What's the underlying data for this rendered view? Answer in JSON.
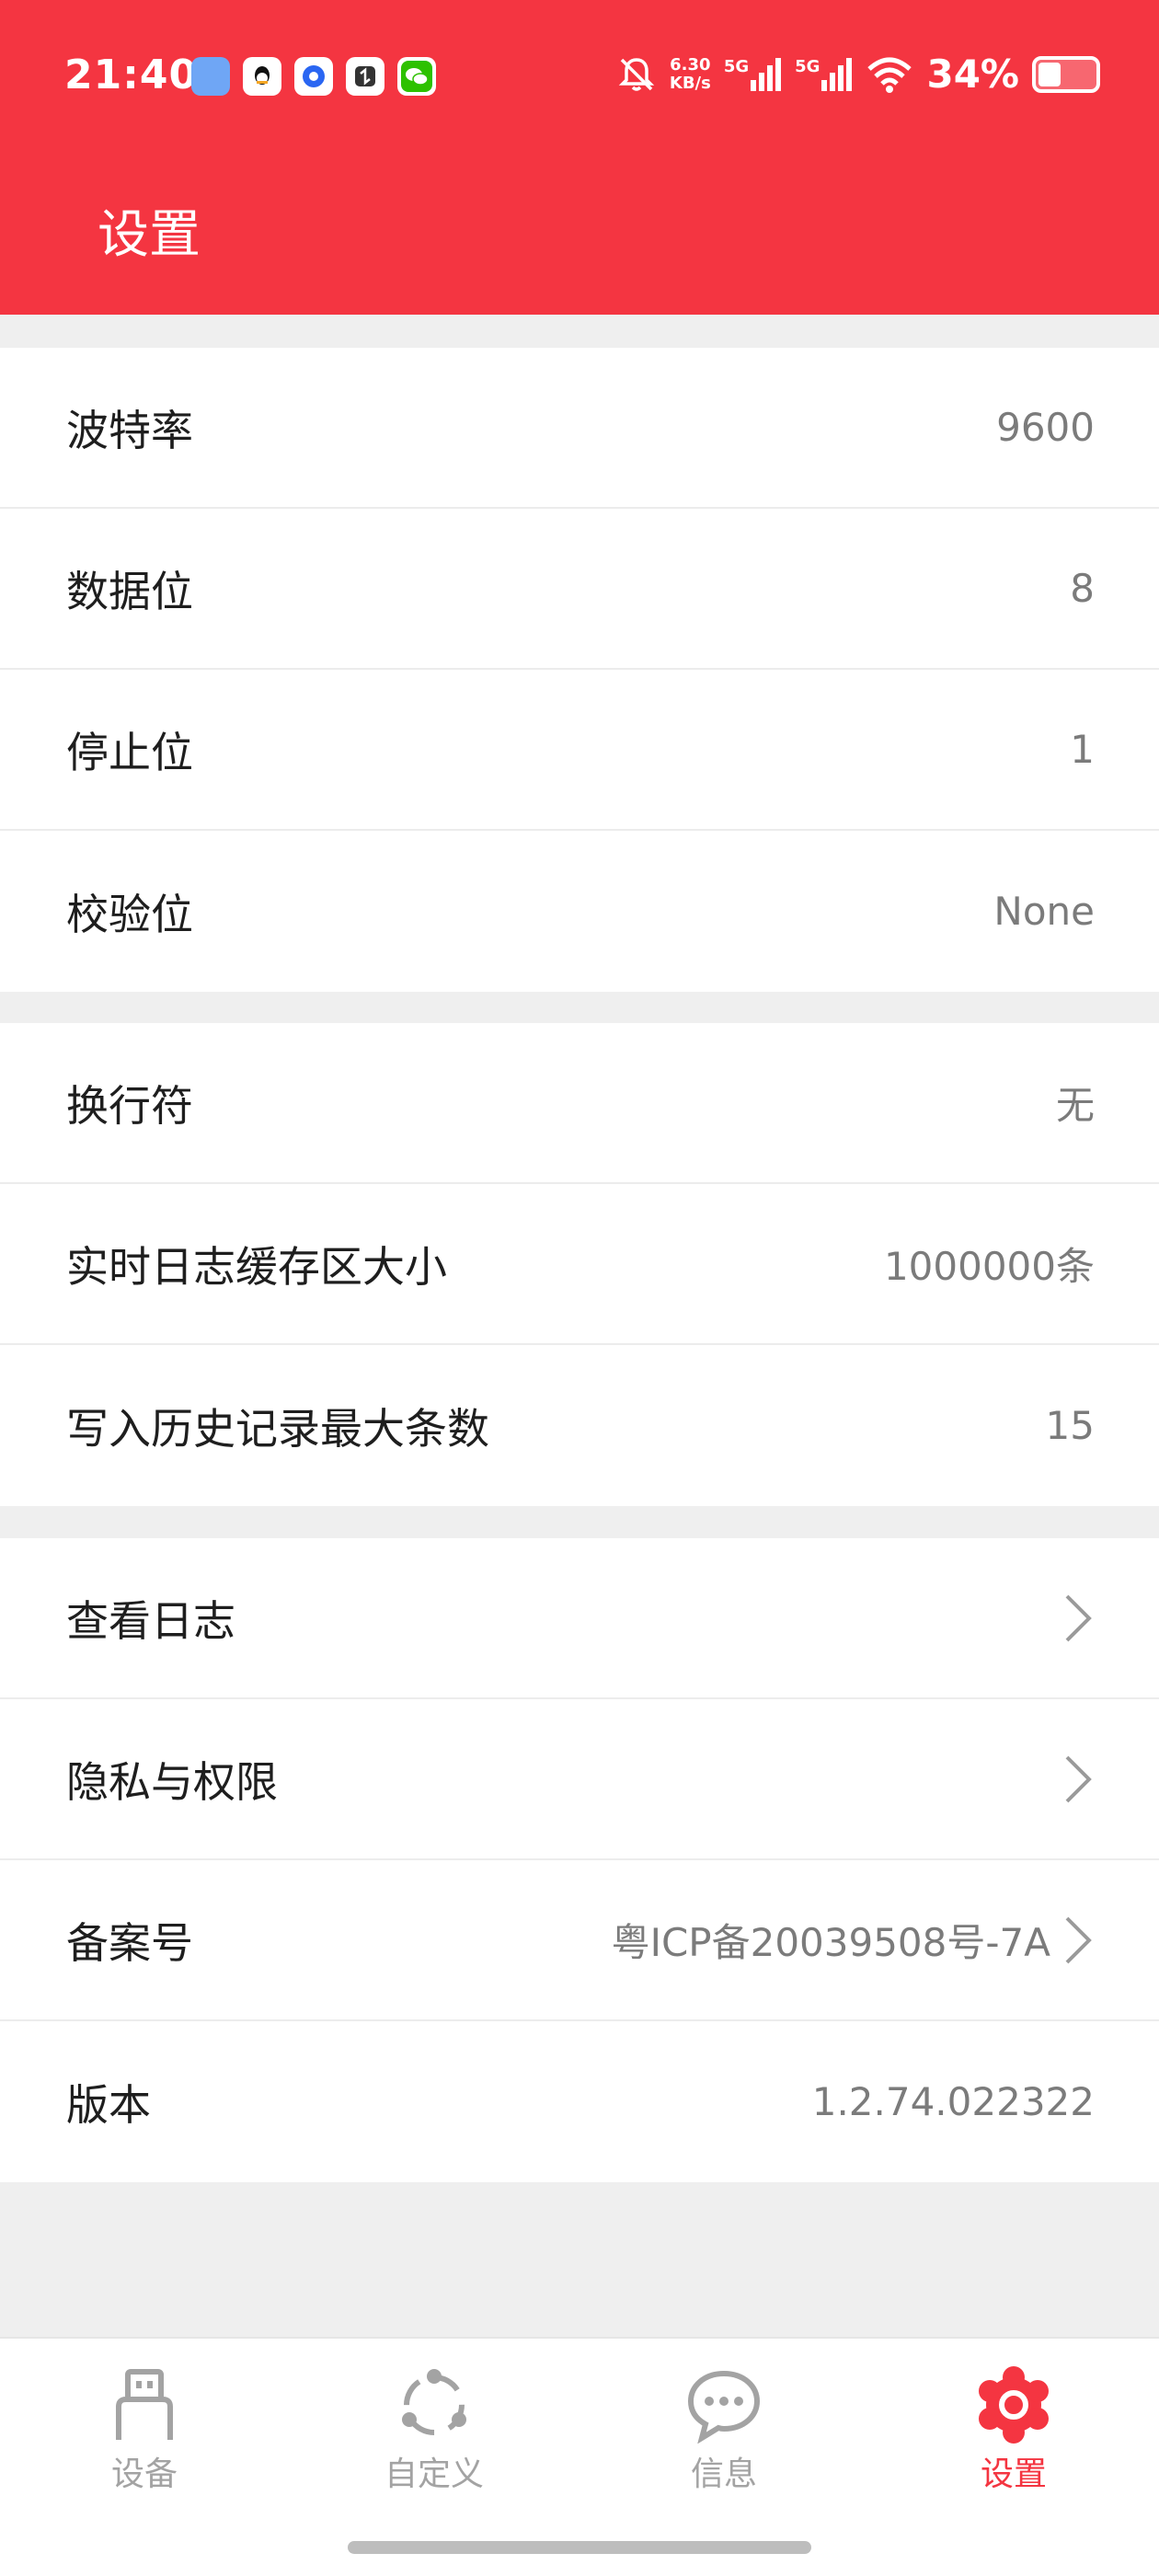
{
  "status_bar": {
    "time": "21:40",
    "net_speed_top": "6.30",
    "net_speed_bottom": "KB/s",
    "signal1": "5G",
    "signal2": "5G",
    "battery": "34%"
  },
  "header": {
    "title": "设置"
  },
  "colors": {
    "accent": "#f43541",
    "tab_inactive": "#a3a3a3",
    "value": "#7b7b7b"
  },
  "groups": [
    {
      "items": [
        {
          "label": "波特率",
          "value": "9600"
        },
        {
          "label": "数据位",
          "value": "8"
        },
        {
          "label": "停止位",
          "value": "1"
        },
        {
          "label": "校验位",
          "value": "None"
        }
      ]
    },
    {
      "items": [
        {
          "label": "换行符",
          "value": "无"
        },
        {
          "label": "实时日志缓存区大小",
          "value": "1000000条"
        },
        {
          "label": "写入历史记录最大条数",
          "value": "15"
        }
      ]
    },
    {
      "items": [
        {
          "label": "查看日志",
          "icon": "chevron-right-icon"
        },
        {
          "label": "隐私与权限",
          "icon": "chevron-right-icon"
        },
        {
          "label": "备案号",
          "value": "粤ICP备20039508号-7A",
          "icon": "chevron-right-icon"
        },
        {
          "label": "版本",
          "value": "1.2.74.022322"
        }
      ]
    }
  ],
  "tabs": [
    {
      "label": "设备",
      "icon": "usb-device-icon",
      "active": false
    },
    {
      "label": "自定义",
      "icon": "share-nodes-icon",
      "active": false
    },
    {
      "label": "信息",
      "icon": "chat-bubble-icon",
      "active": false
    },
    {
      "label": "设置",
      "icon": "gear-icon",
      "active": true
    }
  ]
}
